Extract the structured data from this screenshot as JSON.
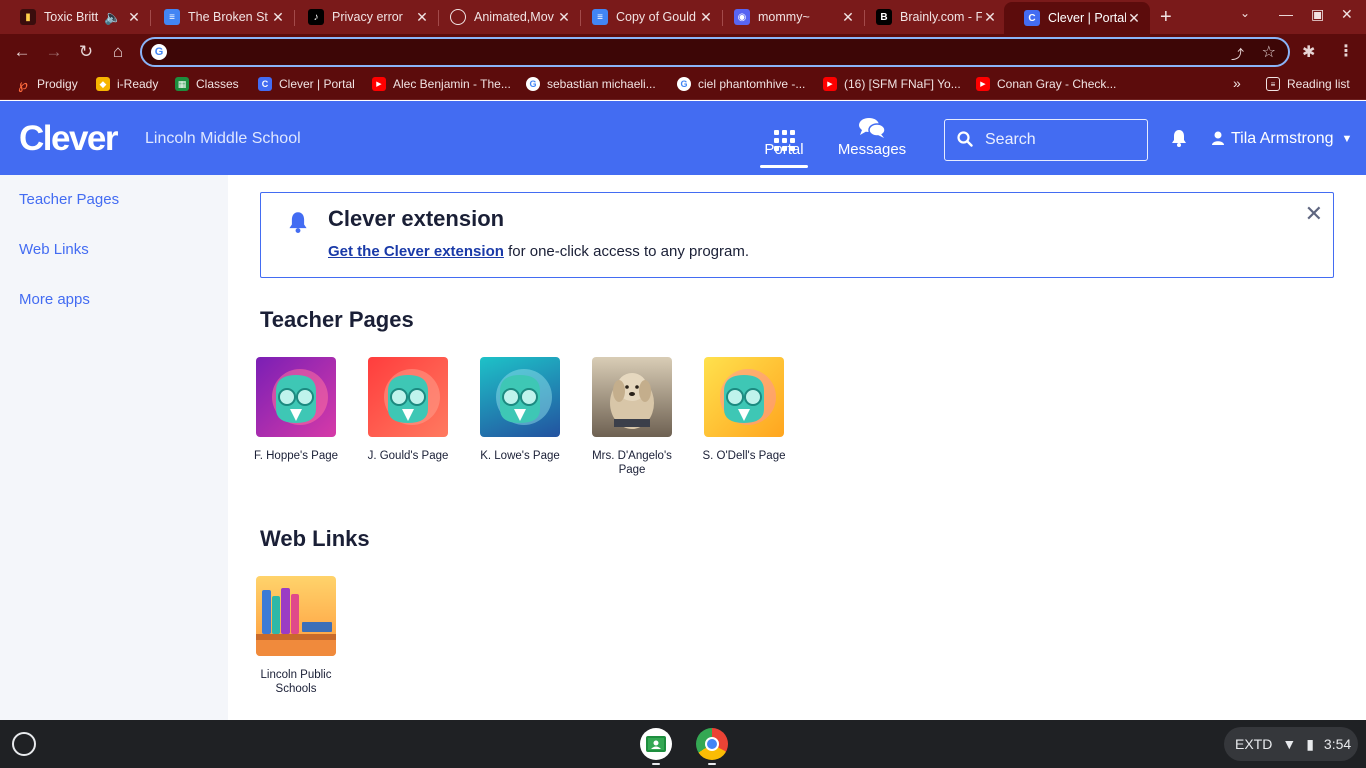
{
  "browser": {
    "tabs": [
      {
        "title": "Toxic Britt",
        "favicon": "waveform-icon",
        "color": "#3a0d0d",
        "has_audio": true
      },
      {
        "title": "The Broken St",
        "favicon": "docs-icon",
        "color": "#4285f4"
      },
      {
        "title": "Privacy error",
        "favicon": "tiktok-icon",
        "color": "#000000"
      },
      {
        "title": "Animated,Mov",
        "favicon": "globe-icon",
        "color": "#5c0c0c"
      },
      {
        "title": "Copy of Gould",
        "favicon": "docs-icon",
        "color": "#4285f4"
      },
      {
        "title": "mommy~",
        "favicon": "discord-icon",
        "color": "#5865f2"
      },
      {
        "title": "Brainly.com - F",
        "favicon": "brainly-icon",
        "color": "#000000"
      },
      {
        "title": "Clever | Portal",
        "favicon": "clever-icon",
        "color": "#436cf2",
        "active": true
      }
    ],
    "omnibox_value": "",
    "bookmarks": [
      {
        "label": "Prodigy",
        "icon": "prodigy-icon",
        "color": "#ff6a3d"
      },
      {
        "label": "i-Ready",
        "icon": "iready-icon",
        "color": "#f7b500"
      },
      {
        "label": "Classes",
        "icon": "classroom-icon",
        "color": "#1e8e3e"
      },
      {
        "label": "Clever | Portal",
        "icon": "clever-icon",
        "color": "#436cf2"
      },
      {
        "label": "Alec Benjamin - The...",
        "icon": "youtube-icon",
        "color": "#ff0000"
      },
      {
        "label": "sebastian michaeli...",
        "icon": "google-icon",
        "color": "#ffffff"
      },
      {
        "label": "ciel phantomhive -...",
        "icon": "google-icon",
        "color": "#ffffff"
      },
      {
        "label": "(16) [SFM FNaF] Yo...",
        "icon": "youtube-icon",
        "color": "#ff0000"
      },
      {
        "label": "Conan Gray - Check...",
        "icon": "youtube-icon",
        "color": "#ff0000"
      }
    ],
    "reading_list": "Reading list",
    "overflow": "»"
  },
  "clever": {
    "logo": "Clever",
    "school": "Lincoln Middle School",
    "nav": {
      "portal": "Portal",
      "messages": "Messages"
    },
    "search_placeholder": "Search",
    "user_name": "Tila Armstrong",
    "brand_color": "#436cf2"
  },
  "sidebar": {
    "items": [
      {
        "label": "Teacher Pages"
      },
      {
        "label": "Web Links"
      },
      {
        "label": "More apps"
      }
    ]
  },
  "banner": {
    "title": "Clever extension",
    "link_text": "Get the Clever extension",
    "body_text": " for one-click access to any program."
  },
  "sections": {
    "teacher_pages": {
      "title": "Teacher Pages",
      "apps": [
        {
          "label": "F. Hoppe's Page",
          "bg": [
            "#7a1fb5",
            "#d63aa8"
          ]
        },
        {
          "label": "J. Gould's Page",
          "bg": [
            "#ff4d4d",
            "#ff6e5a"
          ]
        },
        {
          "label": "K. Lowe's Page",
          "bg": [
            "#1eb5c8",
            "#2660a8"
          ]
        },
        {
          "label": "Mrs. D'Angelo's Page",
          "bg": [
            "#c7b9a3",
            "#6e6152"
          ]
        },
        {
          "label": "S. O'Dell's Page",
          "bg": [
            "#ffd23a",
            "#ffa51f"
          ]
        }
      ]
    },
    "web_links": {
      "title": "Web Links",
      "apps": [
        {
          "label": "Lincoln Public Schools"
        }
      ]
    }
  },
  "shelf": {
    "tray_text": "EXTD",
    "time": "3:54"
  }
}
